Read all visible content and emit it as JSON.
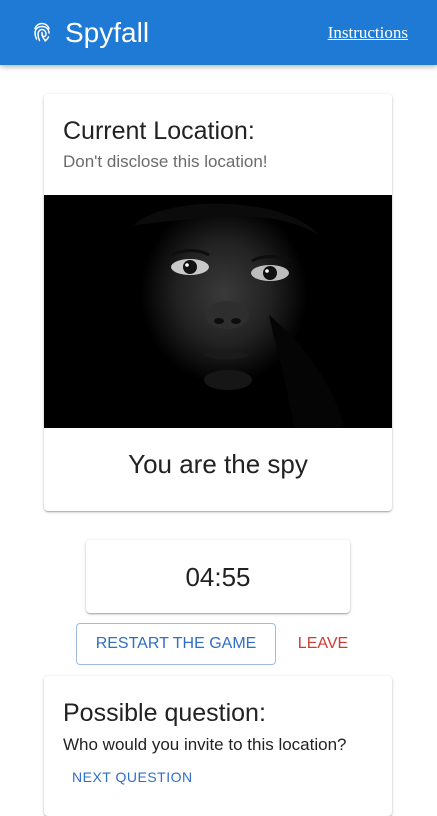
{
  "app": {
    "title": "Spyfall",
    "instructions_label": "Instructions"
  },
  "location_card": {
    "heading": "Current Location:",
    "subtitle": "Don't disclose this location!",
    "role": "You are the spy"
  },
  "timer": {
    "value": "04:55"
  },
  "actions": {
    "restart_label": "RESTART THE GAME",
    "leave_label": "LEAVE"
  },
  "question_card": {
    "heading": "Possible question:",
    "question": "Who would you invite to this location?",
    "next_label": "NEXT QUESTION"
  },
  "colors": {
    "appbar": "#1e7ad4",
    "accent": "#2f6fc4",
    "leave": "#d23b34"
  },
  "icons": {
    "logo": "fingerprint-icon"
  }
}
